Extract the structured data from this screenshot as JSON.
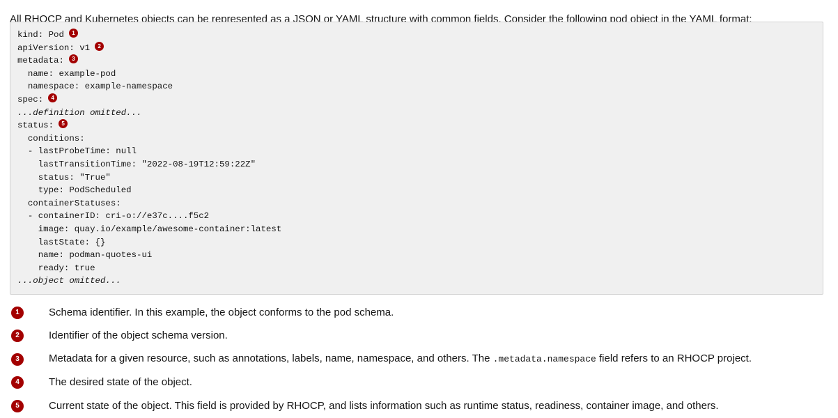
{
  "intro": "All RHOCP and Kubernetes objects can be represented as a JSON or YAML structure with common fields. Consider the following pod object in the YAML format:",
  "code_lines": [
    {
      "text": "kind: Pod",
      "marker": "1"
    },
    {
      "text": "apiVersion: v1",
      "marker": "2"
    },
    {
      "text": "metadata:",
      "marker": "3"
    },
    {
      "text": "  name: example-pod"
    },
    {
      "text": "  namespace: example-namespace"
    },
    {
      "text": "spec:",
      "marker": "4"
    },
    {
      "text": "...definition omitted...",
      "italic": true
    },
    {
      "text": "status:",
      "marker": "5"
    },
    {
      "text": "  conditions:"
    },
    {
      "text": "  - lastProbeTime: null"
    },
    {
      "text": "    lastTransitionTime: \"2022-08-19T12:59:22Z\""
    },
    {
      "text": "    status: \"True\""
    },
    {
      "text": "    type: PodScheduled"
    },
    {
      "text": "  containerStatuses:"
    },
    {
      "text": "  - containerID: cri-o://e37c....f5c2"
    },
    {
      "text": "    image: quay.io/example/awesome-container:latest"
    },
    {
      "text": "    lastState: {}"
    },
    {
      "text": "    name: podman-quotes-ui"
    },
    {
      "text": "    ready: true"
    },
    {
      "text": "...object omitted...",
      "italic": true
    }
  ],
  "callouts": [
    {
      "num": "1",
      "text": "Schema identifier. In this example, the object conforms to the pod schema."
    },
    {
      "num": "2",
      "text": "Identifier of the object schema version."
    },
    {
      "num": "3",
      "text": "Metadata for a given resource, such as annotations, labels, name, namespace, and others. The ",
      "code": ".metadata.namespace",
      "text_after": " field refers to an RHOCP project."
    },
    {
      "num": "4",
      "text": "The desired state of the object."
    },
    {
      "num": "5",
      "text": "Current state of the object. This field is provided by RHOCP, and lists information such as runtime status, readiness, container image, and others."
    }
  ],
  "colors": {
    "badge": "#a30000",
    "code_bg": "#f0f0f0"
  }
}
